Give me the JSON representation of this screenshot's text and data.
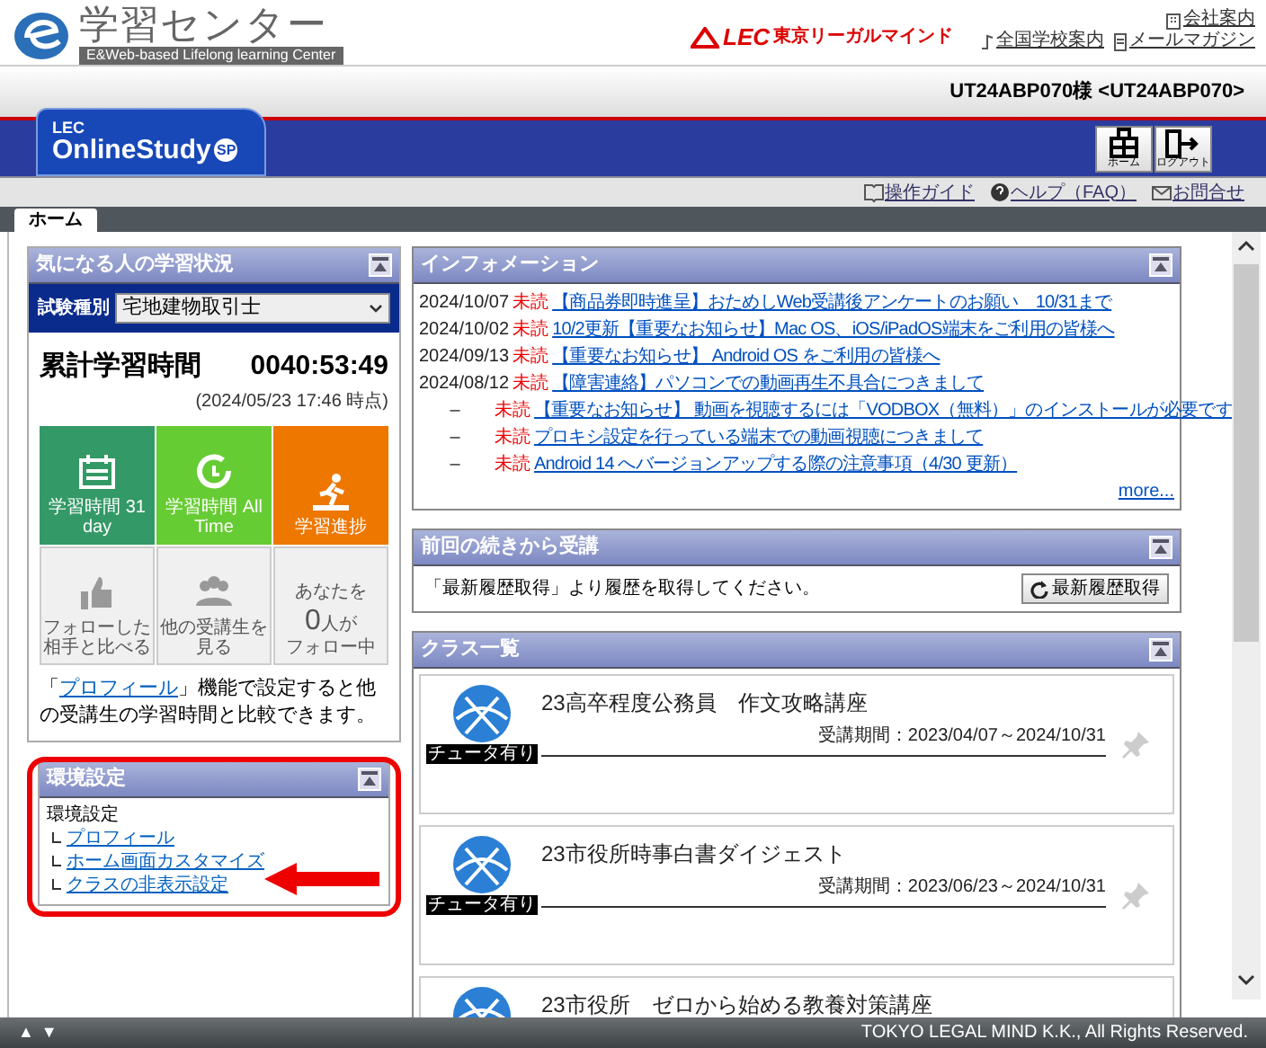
{
  "header": {
    "logo_title": "学習センター",
    "logo_subtitle": "E&Web-based Lifelong learning Center",
    "brand_mark": "LEC",
    "brand_name": "東京リーガルマインド",
    "links": [
      {
        "label": "会社案内",
        "kind": "company"
      },
      {
        "label": "全国学校案内",
        "kind": "school"
      },
      {
        "label": "メールマガジン",
        "kind": "magazine"
      }
    ]
  },
  "user": "UT24ABP070様 <UT24ABP070>",
  "banner": {
    "logo_top": "LEC",
    "logo_main": "OnlineStudy",
    "logo_badge": "SP",
    "buttons": [
      {
        "label": "ホーム",
        "kind": "home"
      },
      {
        "label": "ログアウト",
        "kind": "logout"
      }
    ]
  },
  "help_links": [
    {
      "label": "操作ガイド",
      "kind": "guide"
    },
    {
      "label": "ヘルプ（FAQ）",
      "kind": "help"
    },
    {
      "label": "お問合せ",
      "kind": "mail"
    }
  ],
  "tabs": [
    {
      "label": "ホーム",
      "selected": true
    }
  ],
  "study_panel": {
    "title": "気になる人の学習状況",
    "exam_label": "試験種別",
    "exam_value": "宅地建物取引士",
    "total_label": "累計学習時間",
    "total_value": "0040:53:49",
    "as_of": "(2024/05/23 17:46 時点)",
    "tiles": [
      {
        "kind": "calendar",
        "label": "学習時間 31 day",
        "color": "#339966"
      },
      {
        "kind": "clock",
        "label": "学習時間 All Time",
        "color": "#66cc33"
      },
      {
        "kind": "runner",
        "label": "学習進捗",
        "color": "#ee7700"
      },
      {
        "kind": "thumb",
        "label": "フォローした相手と比べる",
        "color": "#f0f0f0"
      },
      {
        "kind": "people",
        "label": "他の受講生を見る",
        "color": "#f0f0f0"
      },
      {
        "kind": "count",
        "top": "あなたを",
        "count": "0",
        "unit": "人が",
        "label": "フォロー中",
        "color": "#f0f0f0"
      }
    ],
    "note_prefix": "「",
    "note_link": "プロフィール",
    "note_suffix": "」機能で設定すると他の受講生の学習時間と比較できます。"
  },
  "settings_panel": {
    "title": "環境設定",
    "root": "環境設定",
    "children": [
      "プロフィール",
      "ホーム画面カスタマイズ",
      "クラスの非表示設定"
    ]
  },
  "info_panel": {
    "title": "インフォメーション",
    "items": [
      {
        "date": "2024/10/07",
        "status": "未読",
        "text": "【商品券即時進呈】おためしWeb受講後アンケートのお願い　10/31まで"
      },
      {
        "date": "2024/10/02",
        "status": "未読",
        "text": "10/2更新【重要なお知らせ】Mac OS、iOS/iPadOS端末をご利用の皆様へ"
      },
      {
        "date": "2024/09/13",
        "status": "未読",
        "text": "【重要なお知らせ】 Android OS をご利用の皆様へ"
      },
      {
        "date": "2024/08/12",
        "status": "未読",
        "text": "【障害連絡】パソコンでの動画再生不具合につきまして"
      },
      {
        "date": "–",
        "status": "未読",
        "text": "【重要なお知らせ】 動画を視聴するには「VODBOX（無料）」のインストールが必要です"
      },
      {
        "date": "–",
        "status": "未読",
        "text": "プロキシ設定を行っている端末での動画視聴につきまして"
      },
      {
        "date": "–",
        "status": "未読",
        "text": "Android 14 へバージョンアップする際の注意事項（4/30 更新）"
      }
    ],
    "more": "more..."
  },
  "resume_panel": {
    "title": "前回の続きから受講",
    "message": "「最新履歴取得」より履歴を取得してください。",
    "button": "最新履歴取得"
  },
  "class_panel": {
    "title": "クラス一覧",
    "classes": [
      {
        "name": "23高卒程度公務員　作文攻略講座",
        "period": "受講期間：2023/04/07～2024/10/31",
        "badge": "チュータ有り"
      },
      {
        "name": "23市役所時事白書ダイジェスト",
        "period": "受講期間：2023/06/23～2024/10/31",
        "badge": "チュータ有り"
      },
      {
        "name": "23市役所　ゼロから始める教養対策講座"
      }
    ]
  },
  "footer": {
    "scroll_up": "▲",
    "scroll_down": "▼",
    "copyright": "TOKYO LEGAL MIND K.K., All Rights Reserved."
  }
}
